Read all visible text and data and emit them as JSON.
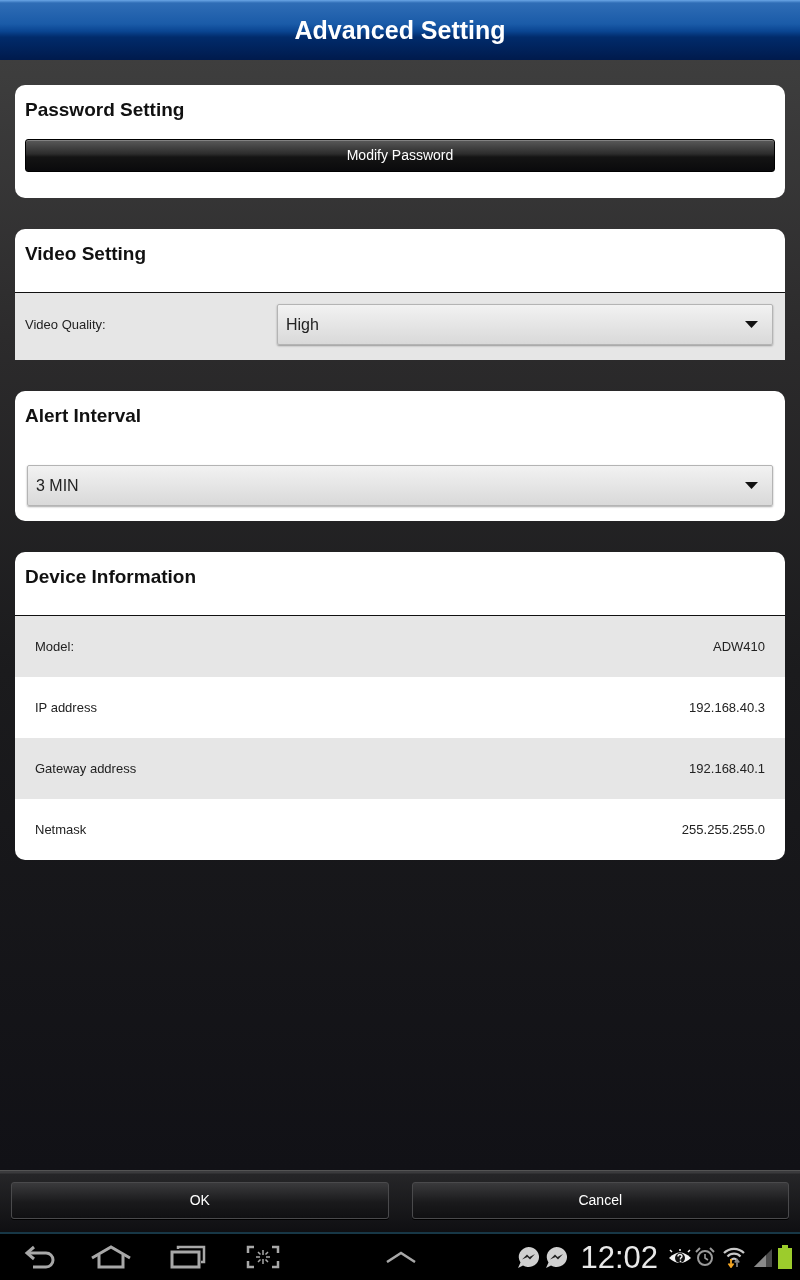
{
  "header": {
    "title": "Advanced Setting"
  },
  "sections": [
    {
      "kind": "button",
      "title": "Password Setting",
      "button": "Modify Password"
    },
    {
      "kind": "labeled_select",
      "title": "Video Setting",
      "label": "Video Quality:",
      "value": "High"
    },
    {
      "kind": "select",
      "title": "Alert Interval",
      "value": "3 MIN"
    },
    {
      "kind": "info",
      "title": "Device Information",
      "rows": [
        {
          "label": "Model:",
          "value": "ADW410"
        },
        {
          "label": "IP address",
          "value": "192.168.40.3"
        },
        {
          "label": "Gateway address",
          "value": "192.168.40.1"
        },
        {
          "label": "Netmask",
          "value": "255.255.255.0"
        }
      ]
    }
  ],
  "footer_buttons": [
    "OK",
    "Cancel"
  ],
  "system_bar": {
    "time": "12:02"
  }
}
